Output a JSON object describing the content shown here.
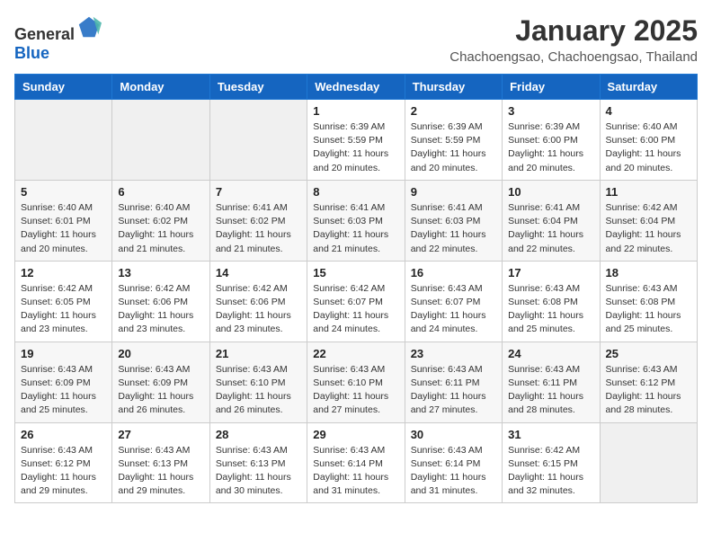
{
  "header": {
    "logo_general": "General",
    "logo_blue": "Blue",
    "month_title": "January 2025",
    "location": "Chachoengsao, Chachoengsao, Thailand"
  },
  "weekdays": [
    "Sunday",
    "Monday",
    "Tuesday",
    "Wednesday",
    "Thursday",
    "Friday",
    "Saturday"
  ],
  "weeks": [
    [
      {
        "day": "",
        "info": ""
      },
      {
        "day": "",
        "info": ""
      },
      {
        "day": "",
        "info": ""
      },
      {
        "day": "1",
        "info": "Sunrise: 6:39 AM\nSunset: 5:59 PM\nDaylight: 11 hours and 20 minutes."
      },
      {
        "day": "2",
        "info": "Sunrise: 6:39 AM\nSunset: 5:59 PM\nDaylight: 11 hours and 20 minutes."
      },
      {
        "day": "3",
        "info": "Sunrise: 6:39 AM\nSunset: 6:00 PM\nDaylight: 11 hours and 20 minutes."
      },
      {
        "day": "4",
        "info": "Sunrise: 6:40 AM\nSunset: 6:00 PM\nDaylight: 11 hours and 20 minutes."
      }
    ],
    [
      {
        "day": "5",
        "info": "Sunrise: 6:40 AM\nSunset: 6:01 PM\nDaylight: 11 hours and 20 minutes."
      },
      {
        "day": "6",
        "info": "Sunrise: 6:40 AM\nSunset: 6:02 PM\nDaylight: 11 hours and 21 minutes."
      },
      {
        "day": "7",
        "info": "Sunrise: 6:41 AM\nSunset: 6:02 PM\nDaylight: 11 hours and 21 minutes."
      },
      {
        "day": "8",
        "info": "Sunrise: 6:41 AM\nSunset: 6:03 PM\nDaylight: 11 hours and 21 minutes."
      },
      {
        "day": "9",
        "info": "Sunrise: 6:41 AM\nSunset: 6:03 PM\nDaylight: 11 hours and 22 minutes."
      },
      {
        "day": "10",
        "info": "Sunrise: 6:41 AM\nSunset: 6:04 PM\nDaylight: 11 hours and 22 minutes."
      },
      {
        "day": "11",
        "info": "Sunrise: 6:42 AM\nSunset: 6:04 PM\nDaylight: 11 hours and 22 minutes."
      }
    ],
    [
      {
        "day": "12",
        "info": "Sunrise: 6:42 AM\nSunset: 6:05 PM\nDaylight: 11 hours and 23 minutes."
      },
      {
        "day": "13",
        "info": "Sunrise: 6:42 AM\nSunset: 6:06 PM\nDaylight: 11 hours and 23 minutes."
      },
      {
        "day": "14",
        "info": "Sunrise: 6:42 AM\nSunset: 6:06 PM\nDaylight: 11 hours and 23 minutes."
      },
      {
        "day": "15",
        "info": "Sunrise: 6:42 AM\nSunset: 6:07 PM\nDaylight: 11 hours and 24 minutes."
      },
      {
        "day": "16",
        "info": "Sunrise: 6:43 AM\nSunset: 6:07 PM\nDaylight: 11 hours and 24 minutes."
      },
      {
        "day": "17",
        "info": "Sunrise: 6:43 AM\nSunset: 6:08 PM\nDaylight: 11 hours and 25 minutes."
      },
      {
        "day": "18",
        "info": "Sunrise: 6:43 AM\nSunset: 6:08 PM\nDaylight: 11 hours and 25 minutes."
      }
    ],
    [
      {
        "day": "19",
        "info": "Sunrise: 6:43 AM\nSunset: 6:09 PM\nDaylight: 11 hours and 25 minutes."
      },
      {
        "day": "20",
        "info": "Sunrise: 6:43 AM\nSunset: 6:09 PM\nDaylight: 11 hours and 26 minutes."
      },
      {
        "day": "21",
        "info": "Sunrise: 6:43 AM\nSunset: 6:10 PM\nDaylight: 11 hours and 26 minutes."
      },
      {
        "day": "22",
        "info": "Sunrise: 6:43 AM\nSunset: 6:10 PM\nDaylight: 11 hours and 27 minutes."
      },
      {
        "day": "23",
        "info": "Sunrise: 6:43 AM\nSunset: 6:11 PM\nDaylight: 11 hours and 27 minutes."
      },
      {
        "day": "24",
        "info": "Sunrise: 6:43 AM\nSunset: 6:11 PM\nDaylight: 11 hours and 28 minutes."
      },
      {
        "day": "25",
        "info": "Sunrise: 6:43 AM\nSunset: 6:12 PM\nDaylight: 11 hours and 28 minutes."
      }
    ],
    [
      {
        "day": "26",
        "info": "Sunrise: 6:43 AM\nSunset: 6:12 PM\nDaylight: 11 hours and 29 minutes."
      },
      {
        "day": "27",
        "info": "Sunrise: 6:43 AM\nSunset: 6:13 PM\nDaylight: 11 hours and 29 minutes."
      },
      {
        "day": "28",
        "info": "Sunrise: 6:43 AM\nSunset: 6:13 PM\nDaylight: 11 hours and 30 minutes."
      },
      {
        "day": "29",
        "info": "Sunrise: 6:43 AM\nSunset: 6:14 PM\nDaylight: 11 hours and 31 minutes."
      },
      {
        "day": "30",
        "info": "Sunrise: 6:43 AM\nSunset: 6:14 PM\nDaylight: 11 hours and 31 minutes."
      },
      {
        "day": "31",
        "info": "Sunrise: 6:42 AM\nSunset: 6:15 PM\nDaylight: 11 hours and 32 minutes."
      },
      {
        "day": "",
        "info": ""
      }
    ]
  ]
}
